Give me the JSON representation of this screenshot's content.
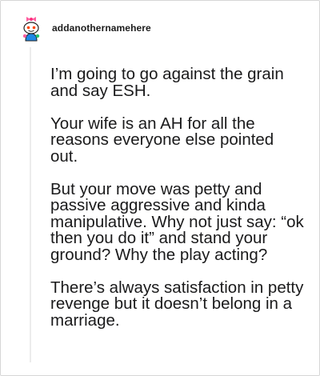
{
  "comment": {
    "username": "addanothernamehere",
    "avatar_icon": "snoo-avatar-icon",
    "paragraphs": [
      "I’m going to go against the grain and say ESH.",
      "Your wife is an AH for all the reasons everyone else pointed out.",
      "But your move was petty and passive aggressive and kinda manipulative. Why not just say: “ok then you do it” and stand your ground? Why the play acting?",
      "There’s always satisfaction in petty revenge but it doesn’t belong in a marriage."
    ]
  },
  "colors": {
    "text": "#1a1a1b",
    "border": "#d6d6d6",
    "avatar_bg": "#ffffff",
    "avatar_accent": "#ff5fa0"
  }
}
